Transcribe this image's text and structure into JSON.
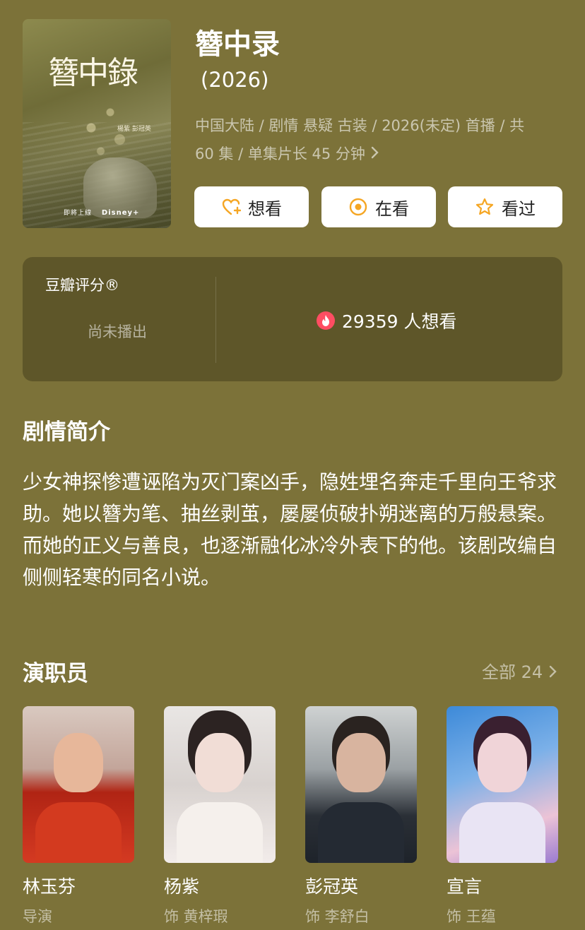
{
  "poster": {
    "title_art": "簪中錄",
    "cast_text": "楊紫 彭冠英",
    "footer": "即將上線",
    "brand": "Disney+"
  },
  "show": {
    "title": "簪中录",
    "year": "(2026)",
    "meta_line1": "中国大陆 / 剧情 悬疑 古装 / 2026(未定) 首播 / 共",
    "meta_line2": "60 集 / 单集片长 45 分钟"
  },
  "actions": {
    "want": "想看",
    "watching": "在看",
    "watched": "看过"
  },
  "rating": {
    "label": "豆瓣评分®",
    "status": "尚未播出",
    "want_count": "29359 人想看"
  },
  "plot": {
    "title": "剧情简介",
    "text": "少女神探惨遭诬陷为灭门案凶手，隐姓埋名奔走千里向王爷求助。她以簪为笔、抽丝剥茧，屡屡侦破扑朔迷离的万般悬案。而她的正义与善良，也逐渐融化冰冷外表下的他。该剧改编自侧侧轻寒的同名小说。"
  },
  "cast": {
    "title": "演职员",
    "all_label": "全部 24",
    "people": [
      {
        "name": "林玉芬",
        "role": "导演"
      },
      {
        "name": "杨紫",
        "role": "饰 黄梓瑕"
      },
      {
        "name": "彭冠英",
        "role": "饰 李舒白"
      },
      {
        "name": "宣言",
        "role": "饰 王蕴"
      }
    ]
  },
  "colors": {
    "background": "#7c7239",
    "accent_orange": "#f5a623",
    "fire_red": "#ff4d62"
  }
}
